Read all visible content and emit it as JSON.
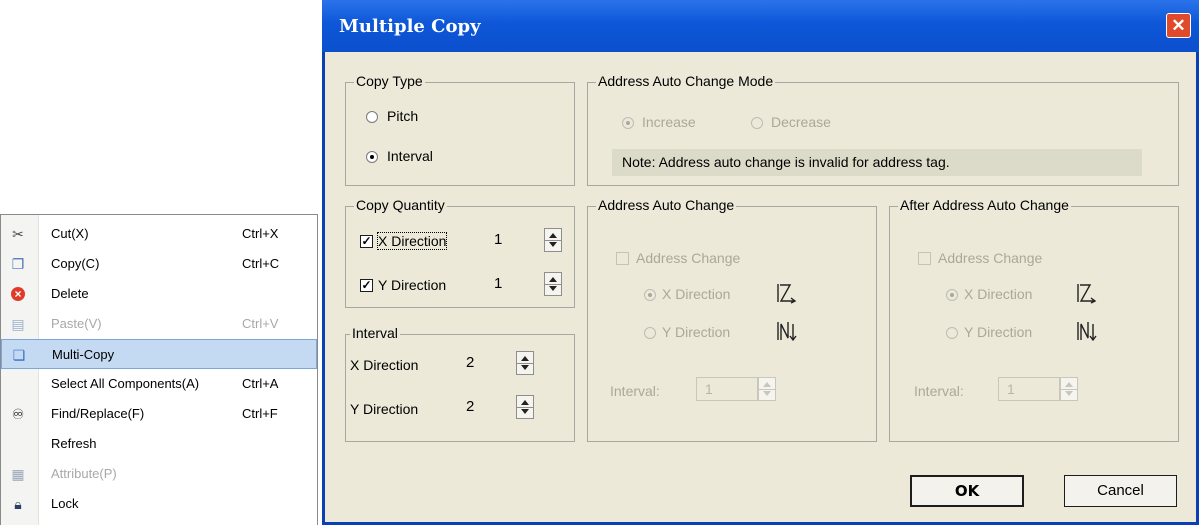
{
  "context_menu": {
    "items": [
      {
        "icon": "scissors-icon",
        "label": "Cut(X)",
        "shortcut": "Ctrl+X",
        "disabled": false,
        "selected": false
      },
      {
        "icon": "copy-icon",
        "label": "Copy(C)",
        "shortcut": "Ctrl+C",
        "disabled": false,
        "selected": false
      },
      {
        "icon": "delete-icon",
        "label": "Delete",
        "shortcut": "",
        "disabled": false,
        "selected": false
      },
      {
        "icon": "paste-icon",
        "label": "Paste(V)",
        "shortcut": "Ctrl+V",
        "disabled": true,
        "selected": false
      },
      {
        "icon": "multi-copy-icon",
        "label": "Multi-Copy",
        "shortcut": "",
        "disabled": false,
        "selected": true
      },
      {
        "icon": "",
        "label": "Select All Components(A)",
        "shortcut": "Ctrl+A",
        "disabled": false,
        "selected": false
      },
      {
        "icon": "binoculars-icon",
        "label": "Find/Replace(F)",
        "shortcut": "Ctrl+F",
        "disabled": false,
        "selected": false
      },
      {
        "icon": "",
        "label": "Refresh",
        "shortcut": "",
        "disabled": false,
        "selected": false
      },
      {
        "icon": "attribute-icon",
        "label": "Attribute(P)",
        "shortcut": "",
        "disabled": true,
        "selected": false
      },
      {
        "icon": "lock-icon",
        "label": "Lock",
        "shortcut": "",
        "disabled": false,
        "selected": false
      }
    ]
  },
  "dialog": {
    "title": "Multiple Copy",
    "close_glyph": "✕",
    "colors": {
      "titlebar": "#0d57d8",
      "face": "#ece9d8",
      "close": "#e04a2c",
      "menu_selected": "#c4d9f2"
    },
    "copy_type": {
      "legend": "Copy Type",
      "pitch": "Pitch",
      "interval": "Interval",
      "selected": "Interval"
    },
    "auto_change_mode": {
      "legend": "Address Auto Change Mode",
      "increase": "Increase",
      "decrease": "Decrease",
      "selected": "Increase",
      "note": "Note: Address auto change is invalid for address tag."
    },
    "copy_quantity": {
      "legend": "Copy Quantity",
      "x_label": "X Direction",
      "x_checked": true,
      "x_value": "1",
      "y_label": "Y Direction",
      "y_checked": true,
      "y_value": "1"
    },
    "interval": {
      "legend": "Interval",
      "x_label": "X Direction",
      "x_value": "2",
      "y_label": "Y Direction",
      "y_value": "2"
    },
    "address_auto_change": {
      "legend": "Address Auto Change",
      "checkbox_label": "Address Change",
      "x_label": "X Direction",
      "y_label": "Y Direction",
      "interval_label": "Interval:",
      "interval_value": "1"
    },
    "after_address_auto_change": {
      "legend": "After Address Auto Change",
      "checkbox_label": "Address Change",
      "x_label": "X Direction",
      "y_label": "Y Direction",
      "interval_label": "Interval:",
      "interval_value": "1"
    },
    "ok_label": "OK",
    "cancel_label": "Cancel"
  }
}
